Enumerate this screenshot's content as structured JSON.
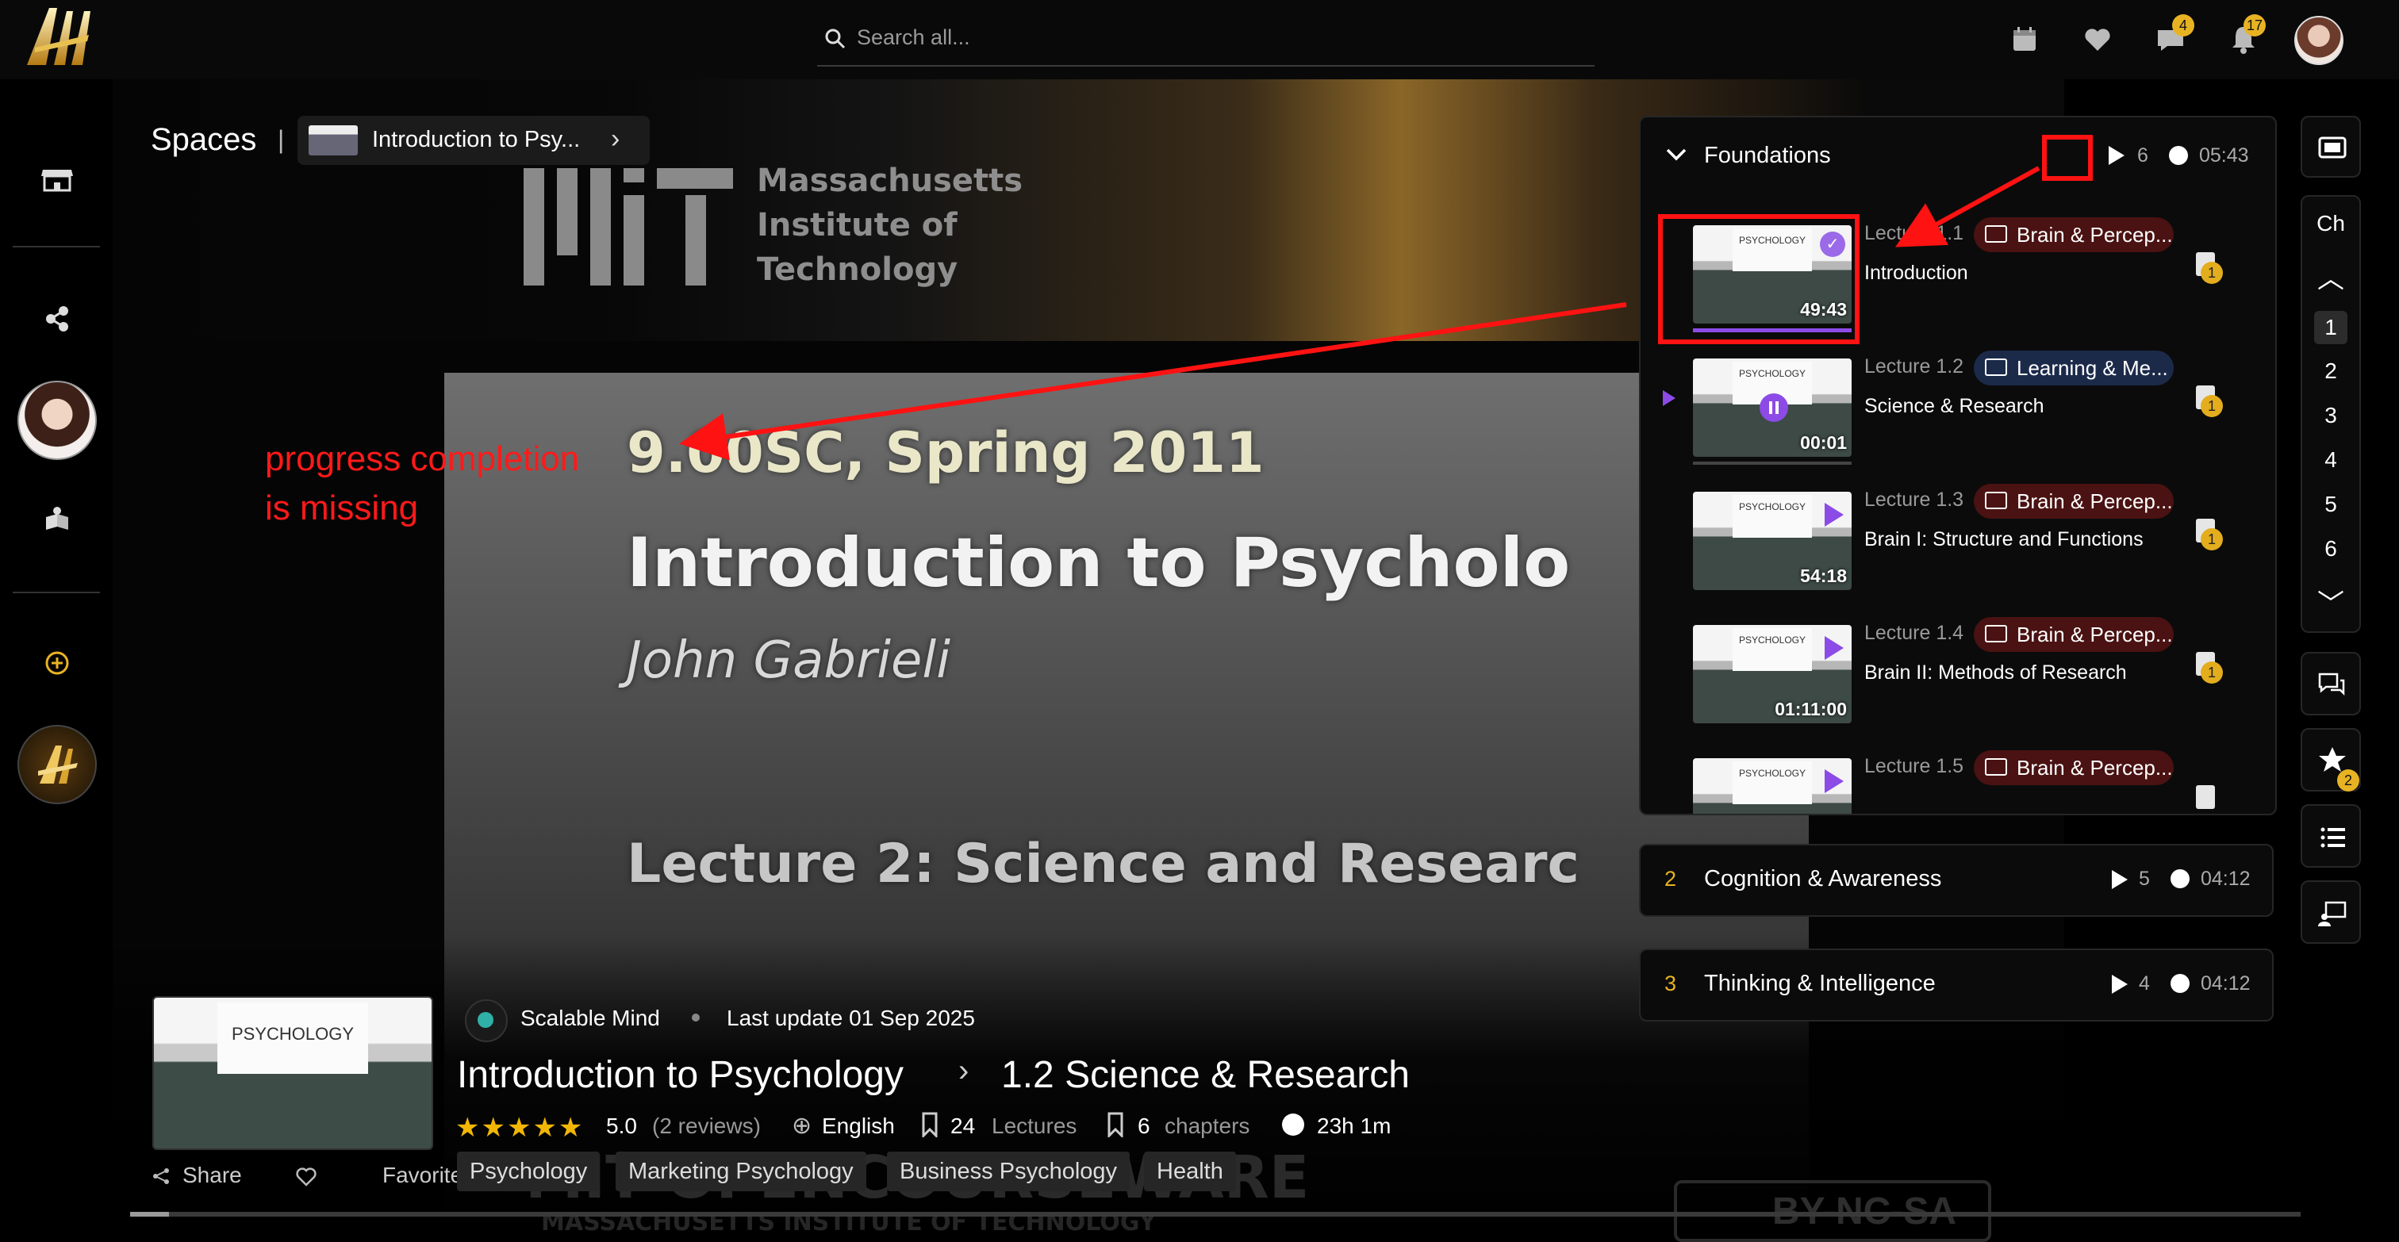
{
  "topbar": {
    "search_placeholder": "Search all...",
    "messages_badge": "4",
    "notifications_badge": "17"
  },
  "breadcrumb": {
    "root": "Spaces",
    "separator": "|",
    "course": "Introduction to Psy..."
  },
  "video_slide": {
    "course_code": "9.00SC, Spring 2011",
    "title": "Introduction to Psycholo",
    "instructor": "John Gabrieli",
    "lecture": "Lecture 2: Science and Researc",
    "mit_text": [
      "Massachusetts",
      "Institute of",
      "Technology"
    ],
    "watermark": "MIT OPENCOURSEWARE",
    "watermark_sub": "MASSACHUSETTS INSTITUTE OF TECHNOLOGY",
    "license": "BY-NC-SA"
  },
  "annotation": {
    "line1": "progress completion",
    "line2": "is missing",
    "color": "#ff1a1a"
  },
  "playlist": {
    "chapter_title": "Foundations",
    "chapter_count": "6",
    "chapter_duration": "05:43",
    "lectures": [
      {
        "num": "Lecture 1.1",
        "tag": "Brain & Percep...",
        "tag_color": "#4a1212",
        "title": "Introduction",
        "duration": "49:43",
        "state": "completed",
        "coin": "1"
      },
      {
        "num": "Lecture 1.2",
        "tag": "Learning & Me...",
        "tag_color": "#1c2a4a",
        "title": "Science & Research",
        "duration": "00:01",
        "state": "playing",
        "coin": "1"
      },
      {
        "num": "Lecture 1.3",
        "tag": "Brain & Percep...",
        "tag_color": "#4a1212",
        "title": "Brain I: Structure and Functions",
        "duration": "54:18",
        "state": "play",
        "coin": "1"
      },
      {
        "num": "Lecture 1.4",
        "tag": "Brain & Percep...",
        "tag_color": "#4a1212",
        "title": "Brain II: Methods of Research",
        "duration": "01:11:00",
        "state": "play",
        "coin": "1"
      },
      {
        "num": "Lecture 1.5",
        "tag": "Brain & Percep...",
        "tag_color": "#4a1212",
        "title": "",
        "duration": "",
        "state": "play",
        "coin": ""
      }
    ],
    "other_chapters": [
      {
        "num": "2",
        "title": "Cognition & Awareness",
        "count": "5",
        "duration": "04:12"
      },
      {
        "num": "3",
        "title": "Thinking & Intelligence",
        "count": "4",
        "duration": "04:12"
      }
    ]
  },
  "rail": {
    "chapter_label": "Ch",
    "chapters": [
      "1",
      "2",
      "3",
      "4",
      "5",
      "6"
    ],
    "active_chapter": "1",
    "favorites_badge": "2"
  },
  "course": {
    "thumb_text": "PSYCHOLOGY",
    "channel": "Scalable Mind",
    "last_update": "Last update 01 Sep 2025",
    "title": "Introduction to Psychology",
    "current_lecture": "1.2 Science & Research",
    "rating": "5.0",
    "stars": 5,
    "reviews": "(2 reviews)",
    "language": "English",
    "lectures_count": "24",
    "lectures_label": "Lectures",
    "chapters_count": "6",
    "chapters_label": "chapters",
    "duration": "23h 1m",
    "share": "Share",
    "favorites": "Favorites",
    "tags": [
      "Psychology",
      "Marketing Psychology",
      "Business Psychology",
      "Health"
    ],
    "video_progress": 0.018
  },
  "colors": {
    "accent_gold": "#e8b323",
    "accent_purple": "#8c4be6"
  }
}
